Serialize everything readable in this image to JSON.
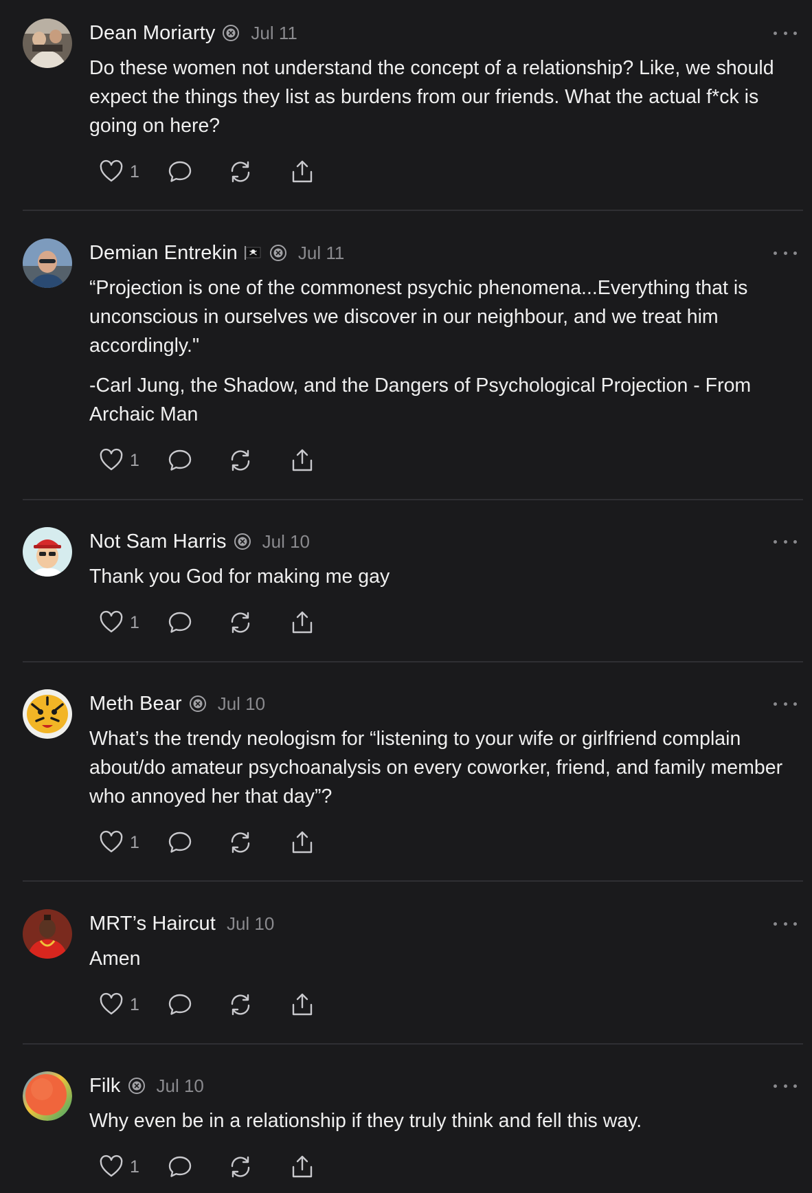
{
  "posts": [
    {
      "author": "Dean Moriarty",
      "date": "Jul 11",
      "verified_badge": true,
      "flag": false,
      "paragraphs": [
        "Do these women not understand the concept of a relationship? Like, we should expect the things they list as burdens from our friends. What the actual f*ck is going on here?"
      ],
      "like_count": "1",
      "avatar": "photo-people-avatar"
    },
    {
      "author": "Demian Entrekin",
      "date": "Jul 11",
      "verified_badge": true,
      "flag": true,
      "paragraphs": [
        "“Projection is one of the commonest psychic phenomena...Everything that is unconscious in ourselves we discover in our neighbour, and we treat him accordingly.\"",
        "-Carl Jung, the Shadow, and the Dangers of Psychological Projection - From Archaic Man"
      ],
      "like_count": "1",
      "avatar": "photo-man-sunglasses-avatar"
    },
    {
      "author": "Not Sam Harris",
      "date": "Jul 10",
      "verified_badge": true,
      "flag": false,
      "paragraphs": [
        "Thank you God for making me gay"
      ],
      "like_count": "1",
      "avatar": "cartoon-red-cap-avatar"
    },
    {
      "author": "Meth Bear",
      "date": "Jul 10",
      "verified_badge": true,
      "flag": false,
      "paragraphs": [
        "What’s the trendy neologism for “listening to your wife or girlfriend complain about/do amateur psychoanalysis on every coworker, friend, and family member who annoyed her that day”?"
      ],
      "like_count": "1",
      "avatar": "tiger-avatar"
    },
    {
      "author": "MRT’s Haircut",
      "date": "Jul 10",
      "verified_badge": false,
      "flag": false,
      "paragraphs": [
        "Amen"
      ],
      "like_count": "1",
      "avatar": "photo-man-red-jacket-avatar"
    },
    {
      "author": "Filk",
      "date": "Jul 10",
      "verified_badge": true,
      "flag": false,
      "paragraphs": [
        "Why even be in a relationship if they truly think and fell this way."
      ],
      "like_count": "1",
      "avatar": "orange-gradient-avatar"
    }
  ],
  "icons": {
    "like": "heart-icon",
    "reply": "comment-bubble-icon",
    "repost": "repost-icon",
    "share": "share-icon",
    "more": "more-dots-icon",
    "badge": "verified-badge-icon"
  },
  "colors": {
    "background": "#1a1a1c",
    "text": "#efefef",
    "muted": "#8a8a8e",
    "divider": "#2f2f33"
  }
}
